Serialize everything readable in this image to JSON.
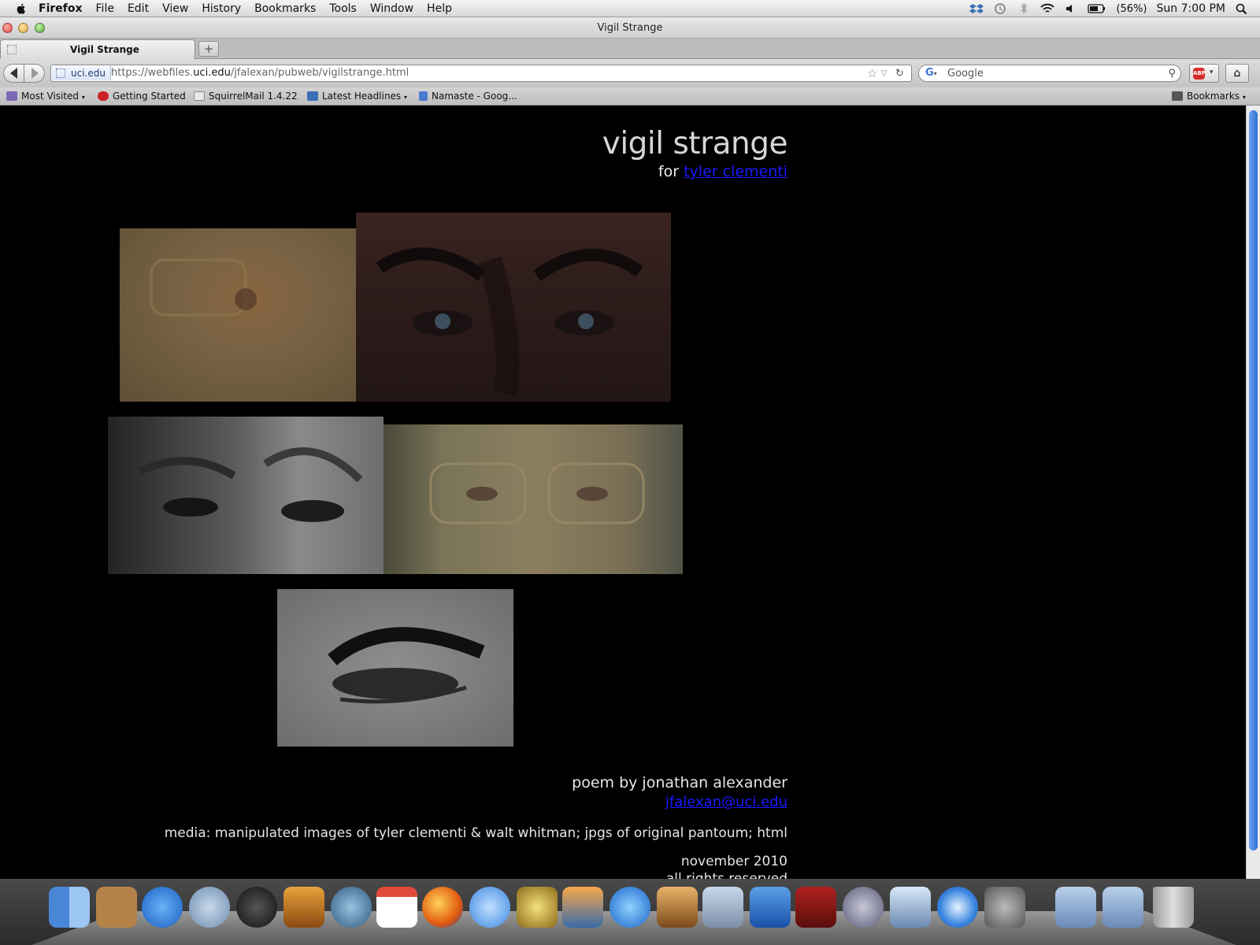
{
  "menubar": {
    "items": [
      "Firefox",
      "File",
      "Edit",
      "View",
      "History",
      "Bookmarks",
      "Tools",
      "Window",
      "Help"
    ],
    "battery": "(56%)",
    "clock": "Sun 7:00 PM"
  },
  "window": {
    "title": "Vigil Strange"
  },
  "tabs": [
    {
      "label": "Vigil Strange"
    }
  ],
  "newtab_label": "+",
  "navbar": {
    "identity": "uci.edu",
    "url_prefix": "https://webfiles.",
    "url_domain": "uci.edu",
    "url_suffix": "/jfalexan/pubweb/vigilstrange.html",
    "search_engine": "Google",
    "search_placeholder": "Google"
  },
  "bookmarks_bar": {
    "items": [
      "Most Visited",
      "Getting Started",
      "SquirrelMail 1.4.22",
      "Latest Headlines",
      "Namaste - Goog..."
    ],
    "menu_label": "Bookmarks"
  },
  "page": {
    "title": "vigil strange",
    "for_prefix": "for ",
    "for_link": "tyler clementi",
    "byline": "poem by jonathan alexander",
    "email": "jfalexan@uci.edu",
    "media": "media: manipulated images of tyler clementi & walt whitman; jpgs of original pantoum; html",
    "date": "november 2010",
    "cut_line": "all rights reserved"
  },
  "images": [
    {
      "name": "eyes-image-1",
      "desc_icon": "eye-photo"
    },
    {
      "name": "eyes-image-2",
      "desc_icon": "eye-photo"
    },
    {
      "name": "eyes-image-3",
      "desc_icon": "eye-photo"
    },
    {
      "name": "eyes-image-4",
      "desc_icon": "eye-photo"
    },
    {
      "name": "eyes-image-5",
      "desc_icon": "eye-photo"
    }
  ],
  "colors": {
    "link": "#1a1aff",
    "page_bg": "#000000",
    "title_text": "#d6d6d6"
  }
}
